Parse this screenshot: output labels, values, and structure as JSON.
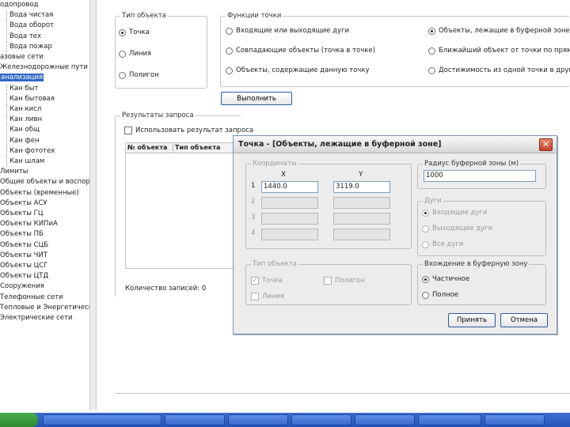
{
  "tree": {
    "items": [
      {
        "label": "одопровод",
        "child": false
      },
      {
        "label": "Вода чистая",
        "child": true
      },
      {
        "label": "Вода оборот",
        "child": true
      },
      {
        "label": "Вода тех",
        "child": true
      },
      {
        "label": "Вода пожар",
        "child": true
      },
      {
        "label": "азовые сети",
        "child": false
      },
      {
        "label": "Железнодорожные пути",
        "child": false
      },
      {
        "label": "анализация",
        "child": false,
        "selected": true
      },
      {
        "label": "Кан быт",
        "child": true
      },
      {
        "label": "Кан бытовая",
        "child": true
      },
      {
        "label": "Кан кисл",
        "child": true
      },
      {
        "label": "Кан ливн",
        "child": true
      },
      {
        "label": "Кан общ",
        "child": true
      },
      {
        "label": "Кан фен",
        "child": true
      },
      {
        "label": "Кан фототех",
        "child": true
      },
      {
        "label": "Кан шлам",
        "child": true
      },
      {
        "label": "Лимиты",
        "child": false
      },
      {
        "label": "Общие объекты и воспорных",
        "child": false
      },
      {
        "label": "Объекты (временные)",
        "child": false
      },
      {
        "label": "Объекты АСУ",
        "child": false
      },
      {
        "label": "Объекты ГЦ",
        "child": false
      },
      {
        "label": "Объекты КИПиА",
        "child": false
      },
      {
        "label": "Объекты ПБ",
        "child": false
      },
      {
        "label": "Объекты СЦБ",
        "child": false
      },
      {
        "label": "Объекты ЧИТ",
        "child": false
      },
      {
        "label": "Объекты ЦСГ",
        "child": false
      },
      {
        "label": "Объекты ЦТД",
        "child": false
      },
      {
        "label": "Сооружения",
        "child": false
      },
      {
        "label": "Телефонные сети",
        "child": false
      },
      {
        "label": "Тепловые и Энергетические",
        "child": false
      },
      {
        "label": "Электрические сети",
        "child": false
      }
    ]
  },
  "object_type": {
    "title": "Тип объекта",
    "options": [
      "Точка",
      "Линия",
      "Полигон"
    ],
    "selected": 0
  },
  "point_functions": {
    "title": "Функции точки",
    "left": [
      "Входящие или выходящие дуги",
      "Совпадающие объекты (точка в точке)",
      "Объекты, содержащие данную точку"
    ],
    "right": [
      "Объекты, лежащие в буферной зоне",
      "Ближайший объект от точки по прямой",
      "Достижимость из одной точки в другую"
    ],
    "selected": "right-0"
  },
  "execute_button": "Выполнить",
  "results": {
    "title": "Результаты запроса",
    "use_result_label": "Использовать результат запроса",
    "columns": [
      "№ объекта",
      "Тип объекта"
    ],
    "count_label": "Количество записей: 0"
  },
  "dialog": {
    "title": "Точка - [Объекты, лежащие в буферной зоне]",
    "close_glyph": "✕",
    "coords": {
      "title": "Координаты",
      "x_header": "X",
      "y_header": "Y",
      "rows": [
        {
          "n": "1",
          "x": "1440.0",
          "y": "3119.0"
        },
        {
          "n": "2",
          "x": "",
          "y": ""
        },
        {
          "n": "3",
          "x": "",
          "y": ""
        },
        {
          "n": "4",
          "x": "",
          "y": ""
        }
      ]
    },
    "radius": {
      "title": "Радиус буферной зоны (м)",
      "value": "1000"
    },
    "arcs": {
      "title": "Дуги",
      "options": [
        "Входящие дуги",
        "Выходящие дуги",
        "Все дуги"
      ]
    },
    "obj_type": {
      "title": "Тип объекта",
      "point": "Точка",
      "polygon": "Полигон",
      "line": "Линия",
      "point_checked": true
    },
    "inclusion": {
      "title": "Вхождение в буферную зону",
      "options": [
        "Частичное",
        "Полное"
      ],
      "selected": 0
    },
    "apply_button": "Принять",
    "cancel_button": "Отмена"
  },
  "colors": {
    "accent": "#316ac5",
    "taskbar": "#2455b8",
    "close": "#c4442a"
  }
}
